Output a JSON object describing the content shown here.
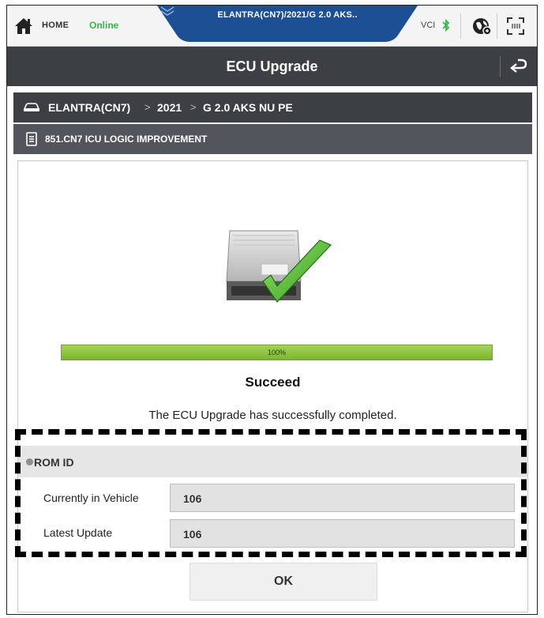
{
  "topbar": {
    "home_label": "HOME",
    "status": "Online",
    "vehicle_title": "ELANTRA(CN7)/2021/G 2.0 AKS..",
    "vci_label": "VCI"
  },
  "titlebar": {
    "title": "ECU Upgrade"
  },
  "breadcrumb": {
    "items": [
      "ELANTRA(CN7)",
      "2021",
      "G 2.0 AKS NU PE"
    ],
    "separator": ">"
  },
  "info": {
    "text": "851.CN7 ICU LOGIC IMPROVEMENT"
  },
  "progress": {
    "value": 100,
    "label": "100%"
  },
  "status": {
    "title": "Succeed",
    "message": "The ECU Upgrade has successfully completed."
  },
  "rom": {
    "title": "ROM ID",
    "rows": [
      {
        "label": "Currently in Vehicle",
        "value": "106"
      },
      {
        "label": "Latest Update",
        "value": "106"
      }
    ]
  },
  "ok_label": "OK",
  "colors": {
    "online": "#39b54a",
    "tab_blue": "#1c4f94",
    "header_dark": "#3c3f44",
    "progress_green": "#8bc63f"
  }
}
